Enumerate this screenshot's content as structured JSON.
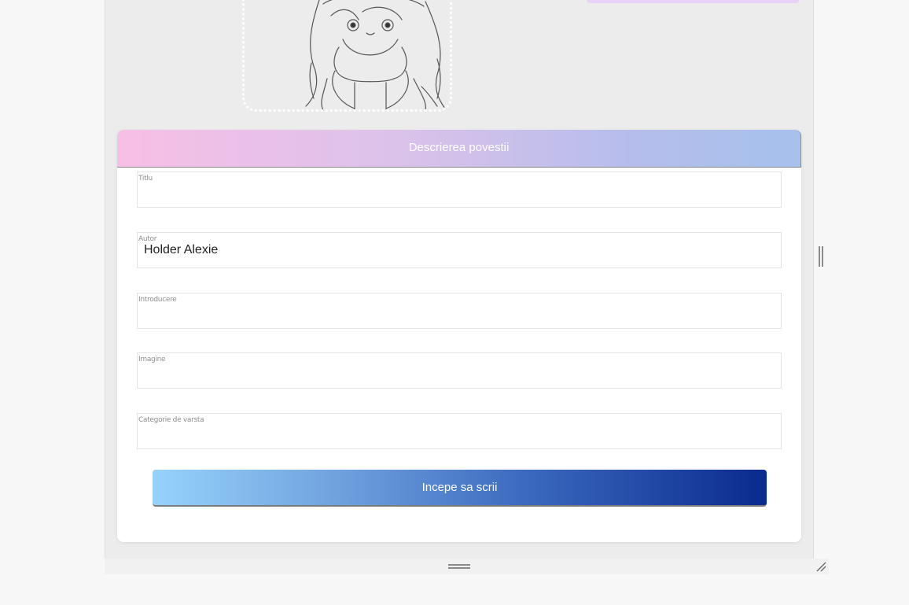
{
  "form": {
    "header_title": "Descrierea povestii",
    "fields": [
      {
        "label": "Titlu",
        "value": ""
      },
      {
        "label": "Autor",
        "value": "Holder Alexie"
      },
      {
        "label": "Introducere",
        "value": ""
      },
      {
        "label": "Imagine",
        "value": ""
      },
      {
        "label": "Categorie de varsta",
        "value": ""
      }
    ],
    "submit_label": "Incepe sa scrii"
  },
  "colors": {
    "header_gradient_start": "#f7bfe6",
    "header_gradient_end": "#a6c1ec",
    "button_gradient_start": "#96d3fb",
    "button_gradient_end": "#0a2a8e"
  }
}
